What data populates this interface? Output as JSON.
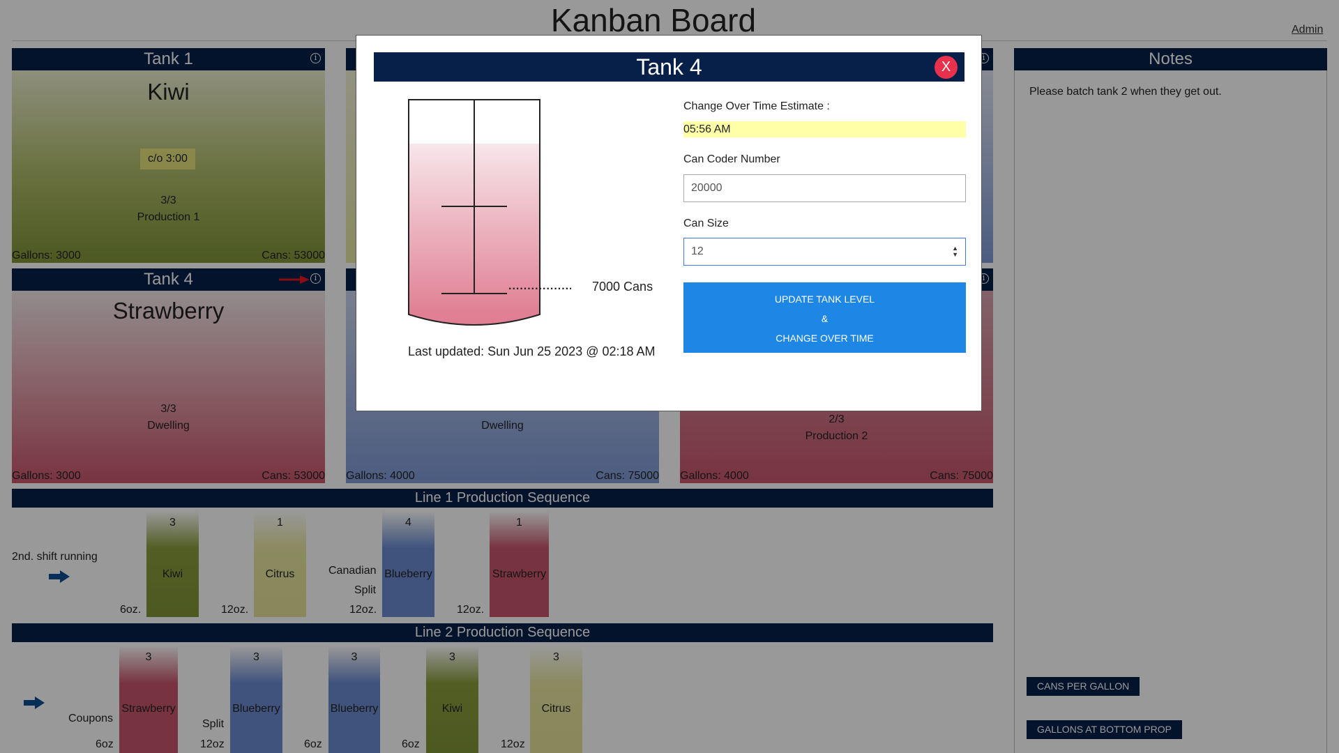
{
  "header": {
    "title": "Kanban Board",
    "admin_link": "Admin"
  },
  "tanks": [
    {
      "name": "Tank 1",
      "flavor": "Kiwi",
      "changeover": "c/o 3:00",
      "count": "3/3",
      "status": "Production 1",
      "gallons": "Gallons: 3000",
      "cans": "Cans: 53000"
    },
    {
      "name": "Tank 4",
      "flavor": "Strawberry",
      "count": "3/3",
      "status": "Dwelling",
      "gallons": "Gallons: 3000",
      "cans": "Cans: 53000"
    },
    {
      "status": "Dwelling",
      "gallons": "Gallons: 4000",
      "cans": "Cans: 75000"
    },
    {
      "count": "2/3",
      "status": "Production 2",
      "gallons": "Gallons: 4000",
      "cans": "Cans: 75000"
    }
  ],
  "line1": {
    "title": "Line 1 Production Sequence",
    "note": "2nd. shift running",
    "items": [
      {
        "size": "6oz.",
        "count": "3",
        "flavor": "Kiwi",
        "label": ""
      },
      {
        "size": "12oz.",
        "count": "1",
        "flavor": "Citrus",
        "label": ""
      },
      {
        "size": "12oz.",
        "count": "4",
        "flavor": "Blueberry",
        "label_1": "Canadian",
        "label_2": "Split"
      },
      {
        "size": "12oz.",
        "count": "1",
        "flavor": "Strawberry",
        "label": ""
      }
    ]
  },
  "line2": {
    "title": "Line 2 Production Sequence",
    "items": [
      {
        "size": "6oz",
        "count": "3",
        "flavor": "Strawberry",
        "label": "Coupons"
      },
      {
        "size": "12oz",
        "count": "3",
        "flavor": "Blueberry",
        "label": "Split"
      },
      {
        "size": "6oz",
        "count": "3",
        "flavor": "Blueberry",
        "label": ""
      },
      {
        "size": "6oz",
        "count": "3",
        "flavor": "Kiwi",
        "label": ""
      },
      {
        "size": "12oz",
        "count": "3",
        "flavor": "Citrus",
        "label": ""
      }
    ]
  },
  "notes": {
    "title": "Notes",
    "text": "Please batch tank 2 when they get out.",
    "btn_cans_per_gallon": "CANS PER GALLON",
    "btn_gallons_bottom_prop": "GALLONS AT BOTTOM PROP"
  },
  "modal": {
    "title": "Tank 4",
    "close": "X",
    "level_label": "7000 Cans",
    "last_updated": "Last updated: Sun Jun 25 2023 @ 02:18 AM",
    "changeover_label": "Change Over Time Estimate :",
    "changeover_value": "05:56 AM",
    "can_coder_label": "Can Coder Number",
    "can_coder_value": "20000",
    "can_size_label": "Can Size",
    "can_size_value": "12",
    "update_line1": "UPDATE TANK LEVEL",
    "update_line2": "&",
    "update_line3": "CHANGE OVER TIME"
  },
  "colors": {
    "navy": "#06204a",
    "kiwi": "#8a9d3c",
    "citrus": "#e8e6a0",
    "blueberry": "#6b8bd1",
    "strawberry": "#c8566b",
    "changeover_highlight": "#ffffa8",
    "update_button": "#1e87e5",
    "close_button": "#e8324d"
  }
}
